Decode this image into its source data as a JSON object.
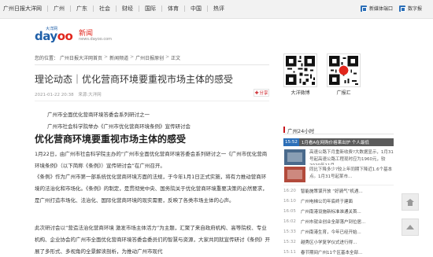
{
  "topnav": {
    "items": [
      "广州日报大洋网",
      "广州",
      "广东",
      "社会",
      "财经",
      "国际",
      "体育",
      "中国",
      "热评"
    ]
  },
  "topright": {
    "media_label": "新媒体端口",
    "digital_label": "数字报"
  },
  "logo": {
    "top_text": "大洋网",
    "brand_prefix": "day",
    "brand_oo": "oo",
    "section": "新闻",
    "domain": "news.dayoo.com"
  },
  "breadcrumb": {
    "prefix": "您的位置：",
    "items": [
      "广州日报大洋网首页",
      "新闻频道",
      "广州日报原创",
      "正文"
    ],
    "arrow": ">"
  },
  "article": {
    "title": "理论动态｜优化营商环境要重视市场主体的感受",
    "date": "2021-01-22 20:38",
    "source": "来源:大洋网",
    "share_label": "分享",
    "sub1": "广州市全面优化营商环境答委会系列研讨之一",
    "sub2": "广州市社会科学院举办《广州市优化营商环境条例》宣传研讨会",
    "big_title": "优化营商环境要重视市场主体的感受",
    "para1": "1月22日，由广州市社会科学院主办的“广州市全面优化营商环境答委会系列研讨之一《广州市优化营商环境条例》（以下简称《条例》）宣传研讨会”在广州召开。",
    "para2": "《条例》作为广州市第一部系统优化营商环境方面的法规，于今年1月1日正式实施，将有力推动营商环境的法治化和市场化。《条例》的制定，是贯彻党中央、国务院关于优化营商环境重要决策的必然要求，是广州打造市场化、法治化、国际化营商环境的现实需要，反映了各类市场主体的心声。",
    "para3": "此次研讨会以“营造法治化营商环境 激发市场主体活力”为主题，汇聚了来自政府机构、高等院校、专业机构、企业协会的广州市全面优化营商环境答委会委员们的智慧与资源，大家共同就宣传研讨《条例》开展了多形式、多视角的全景解读剖析，为推动广州市现代"
  },
  "side": {
    "qr1_label": "大洋微博",
    "qr2_label": "广报汇",
    "section_title": "广州24小时",
    "featured_tag": "15:52",
    "featured_text": "1月看A在网购价格果出炉 个人最低",
    "ff1_text": "高速公路下月重新收费?大数据显示，1月31号起高速公路工程现时应为1960元，较2020年11月",
    "ff2_text": "同比下降多少?较上年同期下降近1.6个基本点。1月31号起某市...",
    "news": [
      {
        "time": "16:20",
        "title": "智能施策谋开放 “好骑气”机遇..."
      },
      {
        "time": "16:10",
        "title": "广州电梯公司年底终于建面"
      },
      {
        "time": "16:05",
        "title": "广州南港设施新标准准通关首..."
      },
      {
        "time": "16:02",
        "title": "广州市就业创业全部落户到位居..."
      },
      {
        "time": "15:33",
        "title": "广州南港生育，今年已经开始..."
      },
      {
        "time": "15:32",
        "title": "越秀区小学复学仪式进行得..."
      },
      {
        "time": "15:11",
        "title": "春节期间广州11个区基本全部..."
      }
    ]
  },
  "colors": {
    "brand_blue": "#1f5fa8",
    "brand_red": "#e1261c",
    "accent_red": "#c8161d"
  }
}
